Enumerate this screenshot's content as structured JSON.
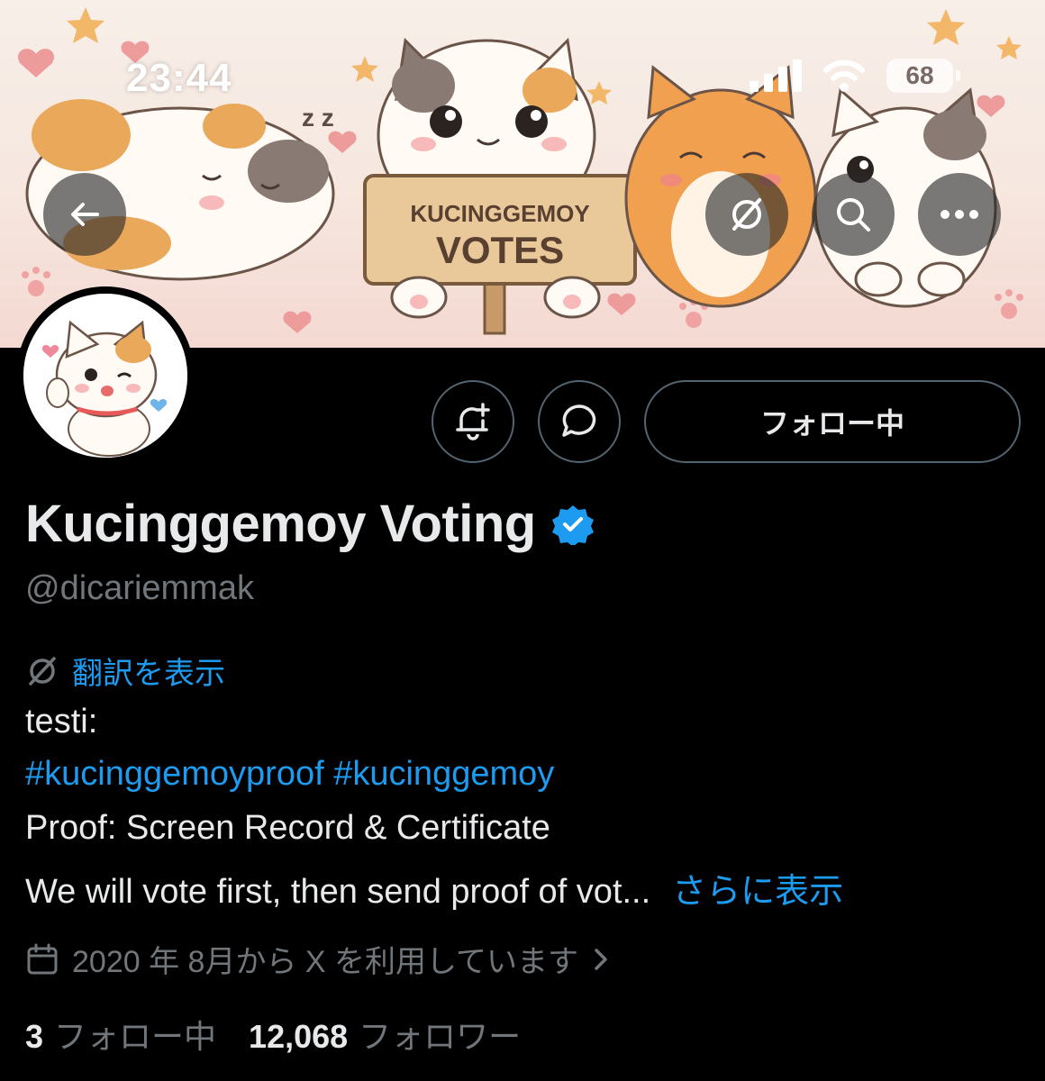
{
  "status_bar": {
    "time": "23:44",
    "battery": "68",
    "icons": [
      "signal-icon",
      "wifi-icon",
      "battery-icon"
    ]
  },
  "banner": {
    "sign_line1": "KUCINGGEMOY",
    "sign_line2": "VOTES",
    "sleep_text": "z z",
    "buttons": [
      "back-arrow-icon",
      "translate-slash-icon",
      "search-icon",
      "more-dots-icon"
    ]
  },
  "actions": {
    "notify_icon": "bell-plus-icon",
    "message_icon": "chat-bubble-icon",
    "follow_label": "フォロー中"
  },
  "profile": {
    "display_name": "Kucinggemoy Voting",
    "verified_badge": "verified-badge-icon",
    "handle": "@dicariemmak",
    "translate_label": "翻訳を表示",
    "bio": {
      "line1": "testi:",
      "hashtag1": "#kucinggemoyproof",
      "hashtag2": "#kucinggemoy",
      "line3": "Proof: Screen Record & Certificate",
      "line4": "We will vote first, then send proof of vot...",
      "more_label": "さらに表示"
    },
    "joined": "2020 年 8月から X を利用しています",
    "following_count": "3",
    "following_label": "フォロー中",
    "followers_count": "12,068",
    "followers_label": "フォロワー"
  },
  "colors": {
    "accent": "#1d9bf0",
    "background": "#000000",
    "muted": "#71767b",
    "border": "#536471"
  }
}
